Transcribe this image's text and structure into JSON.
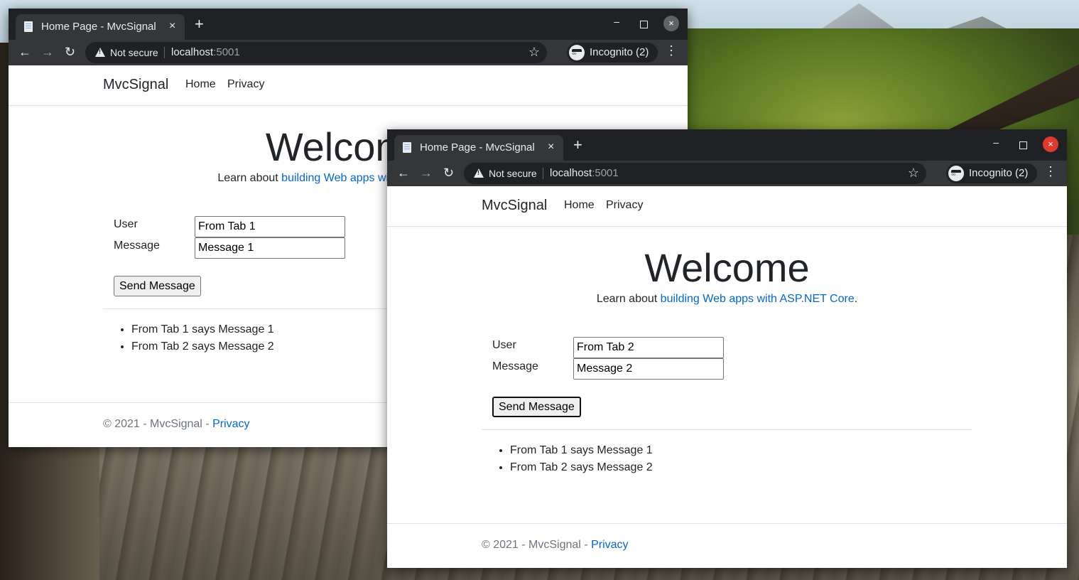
{
  "browser": {
    "tab_title": "Home Page - MvcSignal",
    "tab_close": "×",
    "new_tab": "+",
    "security_label": "Not secure",
    "url_host": "localhost",
    "url_port": ":5001",
    "incognito_label": "Incognito (2)",
    "controls": {
      "minimize": "–",
      "close": "×"
    },
    "nav": {
      "back": "←",
      "forward": "→",
      "reload": "↻",
      "star": "☆",
      "menu": "⋮"
    }
  },
  "site": {
    "brand": "MvcSignal",
    "nav_home": "Home",
    "nav_privacy": "Privacy",
    "welcome": "Welcome",
    "learn_prefix": "Learn about ",
    "learn_link": "building Web apps with ASP.NET Core",
    "learn_suffix": ".",
    "user_label": "User",
    "message_label": "Message",
    "send_button": "Send Message",
    "footer_prefix": "© 2021 - MvcSignal - ",
    "footer_link": "Privacy"
  },
  "windows": [
    {
      "user_value": "From Tab 1",
      "message_value": "Message 1",
      "messages": [
        "From Tab 1 says Message 1",
        "From Tab 2 says Message 2"
      ]
    },
    {
      "user_value": "From Tab 2",
      "message_value": "Message 2",
      "messages": [
        "From Tab 1 says Message 1",
        "From Tab 2 says Message 2"
      ]
    }
  ]
}
